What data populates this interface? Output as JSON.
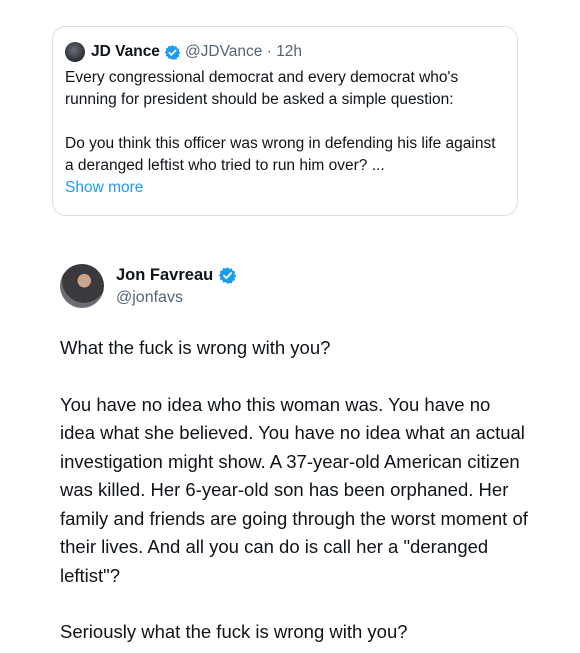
{
  "quoted_tweet": {
    "author_name": "JD Vance",
    "handle_time": "@JDVance · 12h",
    "paragraph_1": "Every congressional democrat and every democrat who's running for president should be asked a simple question:",
    "paragraph_2": "Do you think this officer was wrong in defending his life against a deranged leftist who tried to run him over? ...",
    "show_more": "Show more"
  },
  "tweet": {
    "author_name": "Jon Favreau",
    "handle": "@jonfavs",
    "paragraphs": [
      "What the fuck is wrong with you?",
      "You have no idea who this woman was. You have no idea what she believed. You have no idea what an actual investigation might show. A 37-year-old American citizen was killed. Her 6-year-old son has been orphaned. Her family and friends are going through the worst moment of their lives. And all you can do is call her a \"deranged leftist\"?",
      "Seriously what the fuck is wrong with you?"
    ]
  },
  "icons": {
    "verified": "verified-badge-icon"
  },
  "colors": {
    "accent": "#1d9bf0",
    "text": "#0f1419",
    "muted": "#536471"
  }
}
